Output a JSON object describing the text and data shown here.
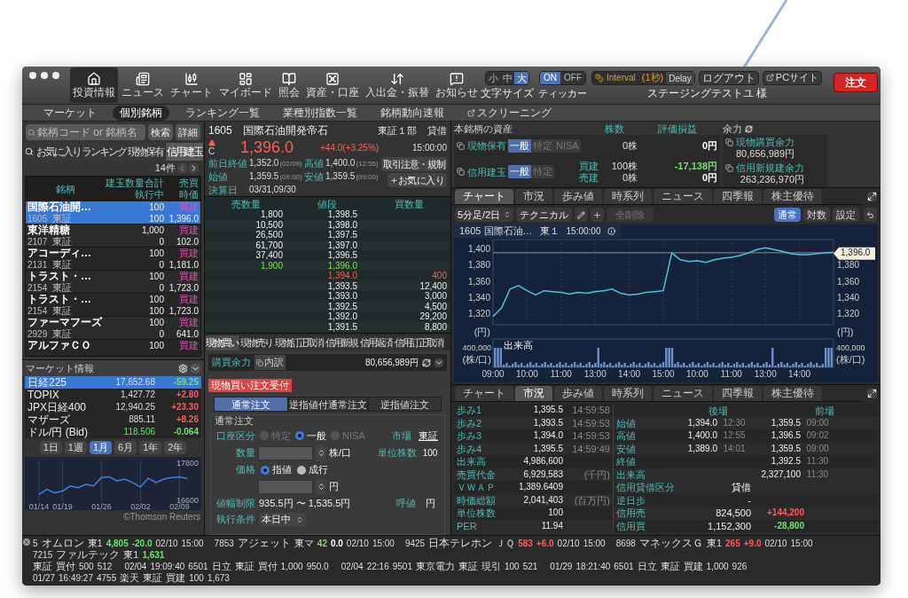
{
  "toolbar": {
    "nav": [
      {
        "label": "投資情報",
        "selected": true
      },
      {
        "label": "ニュース",
        "selected": false
      },
      {
        "label": "チャート",
        "selected": false
      },
      {
        "label": "マイボード",
        "selected": false
      },
      {
        "label": "照会",
        "selected": false
      },
      {
        "label": "資産・口座",
        "selected": false
      },
      {
        "label": "入出金・振替",
        "selected": false
      },
      {
        "label": "お知らせ",
        "selected": false
      }
    ],
    "font_size": {
      "label": "文字サイズ",
      "options": [
        {
          "label": "小",
          "selected": false
        },
        {
          "label": "中",
          "selected": false
        },
        {
          "label": "大",
          "selected": true
        }
      ]
    },
    "ticker_toggle": {
      "label": "ティッカー",
      "options": [
        {
          "label": "ON",
          "selected": true
        },
        {
          "label": "OFF",
          "selected": false
        }
      ]
    },
    "interval": {
      "label": "Interval",
      "value": "(1秒)",
      "button": "Delay"
    },
    "user": {
      "name": "ステージングテストユ",
      "suffix": "様"
    },
    "logout": "ログアウト",
    "pc_site": "PCサイト",
    "order": "注文"
  },
  "subnav": [
    {
      "label": "マーケット",
      "selected": false,
      "kind": "tab"
    },
    {
      "label": "個別銘柄",
      "selected": true,
      "kind": "tab"
    },
    {
      "label": "ランキング一覧",
      "selected": false,
      "kind": "tab"
    },
    {
      "label": "業種別指数一覧",
      "selected": false,
      "kind": "tab"
    },
    {
      "label": "銘柄動向速報",
      "selected": false,
      "kind": "tab"
    },
    {
      "label": "スクリーニング",
      "selected": false,
      "kind": "external"
    }
  ],
  "watchlist": {
    "search": {
      "placeholder": "銘柄コード or 銘柄名",
      "buttons": [
        "検索",
        "詳細"
      ]
    },
    "tabs": [
      {
        "label": "お気に入り",
        "selected": false
      },
      {
        "label": "ランキング",
        "selected": false
      },
      {
        "label": "現物保有",
        "selected": false
      },
      {
        "label": "信用建玉",
        "selected": true
      }
    ],
    "count": "14件",
    "columns": [
      [
        "銘柄"
      ],
      [
        "建玉数量合計",
        "執行中"
      ],
      [
        "売買",
        "時価"
      ]
    ],
    "rows": [
      {
        "name": "国際石油開…",
        "code": "1605",
        "market": "東証",
        "qty": "100",
        "pending": "100",
        "side": "買建",
        "price": "1,396.0",
        "selected": true
      },
      {
        "name": "東洋精糖",
        "code": "2107",
        "market": "東証",
        "qty": "1,000",
        "pending": "0",
        "side": "買建",
        "price": "102.0",
        "selected": false
      },
      {
        "name": "アコーディ…",
        "code": "2131",
        "market": "東証",
        "qty": "100",
        "pending": "0",
        "side": "買建",
        "price": "1,181.0",
        "selected": false
      },
      {
        "name": "トラスト・…",
        "code": "2154",
        "market": "東証",
        "qty": "100",
        "pending": "0",
        "side": "買建",
        "price": "1,723.0",
        "selected": false
      },
      {
        "name": "トラスト・…",
        "code": "2154",
        "market": "東証",
        "qty": "100",
        "pending": "100",
        "side": "買建",
        "price": "1,723.0",
        "selected": false
      },
      {
        "name": "ファーマフーズ",
        "code": "2929",
        "market": "東証",
        "qty": "100",
        "pending": "0",
        "side": "買建",
        "price": "641.0",
        "selected": false
      },
      {
        "name": "アルファＣＯ",
        "qty": "100",
        "side": "買建",
        "selected": false
      }
    ]
  },
  "market_info": {
    "title": "マーケット情報",
    "rows": [
      {
        "name": "日経225",
        "value": "17,652.68",
        "change": "-59.25",
        "color": "#6ee06e",
        "selected": true,
        "value_highlight": false
      },
      {
        "name": "TOPIX",
        "value": "1,427.72",
        "change": "+2.80",
        "color": "#ff5b5b",
        "selected": false,
        "value_highlight": false
      },
      {
        "name": "JPX日経400",
        "value": "12,940.25",
        "change": "+23.30",
        "color": "#ff5b5b",
        "selected": false,
        "value_highlight": false
      },
      {
        "name": "マザーズ",
        "value": "885.11",
        "change": "+8.26",
        "color": "#ff5b5b",
        "selected": false,
        "value_highlight": false
      },
      {
        "name": "ドル/円 (Bid)",
        "value": "118.506",
        "change": "-0.064",
        "color": "#6ee06e",
        "selected": false,
        "value_highlight": true
      }
    ],
    "periods": [
      {
        "label": "1日",
        "selected": false
      },
      {
        "label": "1週",
        "selected": false
      },
      {
        "label": "1月",
        "selected": true
      },
      {
        "label": "6月",
        "selected": false
      },
      {
        "label": "1年",
        "selected": false
      },
      {
        "label": "2年",
        "selected": false
      }
    ],
    "chart_data": {
      "type": "line",
      "grid": true,
      "categories": [
        "01/14",
        null,
        null,
        "01/19",
        null,
        null,
        null,
        null,
        "01/26",
        null,
        null,
        null,
        null,
        "02/02",
        null,
        null,
        null,
        null,
        "02/09",
        null
      ],
      "ylim": [
        16600,
        17800
      ],
      "yticks": [
        16600,
        17800
      ],
      "series": [
        {
          "color": "#3f7fd8",
          "values": [
            16800,
            16950,
            16850,
            16900,
            17050,
            17000,
            17100,
            17050,
            17300,
            17320,
            17200,
            17250,
            17150,
            17020,
            17280,
            17150,
            17250,
            17300,
            17320,
            17270
          ]
        }
      ]
    },
    "credit": "©Thomson Reuters"
  },
  "quote": {
    "code": "1605",
    "name": "国際石油開発帝石",
    "market": "東証１部",
    "margin": "貸借",
    "rising": true,
    "color": "#ff5b5b",
    "flag": "C",
    "price": "1,396.0",
    "change": "+44.0(+3.25%)",
    "time": "15:00:00",
    "stats": [
      {
        "label": "前日終値",
        "value": "1,352.0",
        "note": "(02/09)"
      },
      {
        "label": "高値",
        "value": "1,400.0",
        "note": "(12:55)"
      },
      {
        "label": "始値",
        "value": "1,359.5",
        "note": "(09:00)"
      },
      {
        "label": "安値",
        "value": "1,359.5",
        "note": "(09:00)"
      },
      {
        "label": "決算日",
        "value": "03/31,09/30"
      }
    ],
    "buttons": {
      "caution": "取引注意・規制",
      "favorite": "お気に入り"
    }
  },
  "order_book": {
    "columns": [
      "売数量",
      "値段",
      "買数量"
    ],
    "rows": [
      {
        "kind": "sell",
        "sell_qty": "1,800",
        "price": "1,398.5"
      },
      {
        "kind": "sell",
        "sell_qty": "10,500",
        "price": "1,398.0"
      },
      {
        "kind": "sell",
        "sell_qty": "26,500",
        "price": "1,397.5"
      },
      {
        "kind": "sell",
        "sell_qty": "61,700",
        "price": "1,397.0"
      },
      {
        "kind": "sell",
        "sell_qty": "37,400",
        "price": "1,396.5"
      },
      {
        "kind": "current",
        "sell_qty": "1,900",
        "price": "1,396.0"
      },
      {
        "kind": "best_buy",
        "price": "1,394.0",
        "buy_qty": "400"
      },
      {
        "kind": "buy",
        "price": "1,393.5",
        "buy_qty": "12,400"
      },
      {
        "kind": "buy",
        "price": "1,393.0",
        "buy_qty": "3,000"
      },
      {
        "kind": "buy",
        "price": "1,392.5",
        "buy_qty": "4,500"
      },
      {
        "kind": "buy",
        "price": "1,392.0",
        "buy_qty": "29,200"
      },
      {
        "kind": "buy",
        "price": "1,391.5",
        "buy_qty": "8,800"
      }
    ]
  },
  "order": {
    "tabs": [
      {
        "label": "現物買い",
        "selected": true
      },
      {
        "label": "現物売り",
        "selected": false
      },
      {
        "label": "現物訂正取消",
        "selected": false
      },
      {
        "label": "信用新規",
        "selected": false
      },
      {
        "label": "信用返済",
        "selected": false
      },
      {
        "label": "信用訂正取消",
        "selected": false
      }
    ],
    "power": {
      "label": "購買余力",
      "breakdown": "内訳",
      "value": "80,656,989円"
    },
    "status": "現物買い注文受付",
    "types": [
      {
        "label": "通常注文",
        "selected": true
      },
      {
        "label": "逆指値付通常注文",
        "selected": false
      },
      {
        "label": "逆指値注文",
        "selected": false
      }
    ],
    "legend": "通常注文",
    "account": {
      "label": "口座区分",
      "options": [
        {
          "label": "特定",
          "selected": false,
          "disabled": true
        },
        {
          "label": "一般",
          "selected": true,
          "disabled": false
        },
        {
          "label": "NISA",
          "selected": false,
          "disabled": true
        }
      ]
    },
    "market": {
      "label": "市場",
      "value": "東証"
    },
    "quantity": {
      "label": "数量",
      "unit": "株/口"
    },
    "unit_shares": {
      "label": "単位株数",
      "value": "100"
    },
    "price": {
      "label": "価格",
      "options": [
        {
          "label": "指値",
          "selected": true,
          "disabled": false
        },
        {
          "label": "成行",
          "selected": false,
          "disabled": false
        }
      ],
      "unit": "円"
    },
    "limit": {
      "label": "値幅制限",
      "value": "935.5円 〜 1,535.5円"
    },
    "tick": {
      "label": "呼値",
      "value": "円"
    },
    "condition": {
      "label": "執行条件",
      "value": "本日中"
    }
  },
  "assets": {
    "title": "本銘柄の資産",
    "columns": [
      "株数",
      "評価損益"
    ],
    "power_title": "余力",
    "rows": [
      {
        "label": "現物保有",
        "accounts": [
          {
            "label": "一般",
            "selected": true
          },
          {
            "label": "特定",
            "selected": false
          },
          {
            "label": "NISA",
            "selected": false
          }
        ],
        "lines": [
          {
            "shares": "0株",
            "pl": "0円",
            "color": "#ffffff"
          }
        ]
      },
      {
        "label": "信用建玉",
        "accounts": [
          {
            "label": "一般",
            "selected": true
          },
          {
            "label": "特定",
            "selected": false
          }
        ],
        "lines": [
          {
            "side": "買建",
            "shares": "100株",
            "pl": "-17,138円",
            "color": "#6ee06e"
          },
          {
            "side": "売建",
            "shares": "0株",
            "pl": "0円",
            "color": "#ffffff"
          }
        ]
      }
    ],
    "power": [
      {
        "label": "現物購買余力",
        "value": "80,656,989円"
      },
      {
        "label": "信用新規建余力",
        "value": "263,236,970円"
      }
    ]
  },
  "chart_panel": {
    "tabs": [
      {
        "label": "チャート",
        "selected": true
      },
      {
        "label": "市況",
        "selected": false
      },
      {
        "label": "歩み値",
        "selected": false
      },
      {
        "label": "時系列",
        "selected": false
      },
      {
        "label": "ニュース",
        "selected": false
      },
      {
        "label": "四季報",
        "selected": false
      },
      {
        "label": "株主優待",
        "selected": false
      }
    ],
    "period": "5分足/2日",
    "technical": "テクニカル",
    "clear": "全削除",
    "scales": [
      {
        "label": "通常",
        "selected": true
      },
      {
        "label": "対数",
        "selected": false
      },
      {
        "label": "設定",
        "selected": false
      }
    ],
    "legend": {
      "name": "1605 国際石油…",
      "market": "東１",
      "time": "15:00:00"
    },
    "last_label": "1,396.0",
    "units": [
      "(円)",
      "(円)"
    ],
    "volume_label": "出来高",
    "volume_ticks": [
      "400,000",
      "400,000"
    ],
    "volume_units": [
      "(株/口)",
      "(株/口)"
    ],
    "chart_data": {
      "type": "line",
      "grid": true,
      "ref_lines": [
        {
          "axis": "y",
          "value": 1396
        }
      ],
      "categories": [
        "09:00",
        null,
        null,
        null,
        "10:00",
        null,
        null,
        null,
        "11:00",
        null,
        null,
        null,
        "13:00",
        null,
        null,
        null,
        "14:00",
        null,
        null,
        null,
        "15:00",
        null,
        null,
        null,
        "10:00",
        null,
        null,
        null,
        "11:00",
        null,
        null,
        null,
        "13:00",
        null,
        null,
        null,
        "14:00",
        null,
        null,
        null,
        null
      ],
      "ylim": [
        1310,
        1410
      ],
      "yticks": [
        {
          "value": 1320,
          "label": "1,320"
        },
        {
          "value": 1340,
          "label": "1,340"
        },
        {
          "value": 1360,
          "label": "1,360"
        },
        {
          "value": 1380,
          "label": "1,380"
        },
        {
          "value": 1400,
          "label": "1,400"
        }
      ],
      "series": [
        {
          "color": "#4fc3d9",
          "values": [
            1320,
            1330,
            1352,
            1356,
            1350,
            1345,
            1350,
            1349,
            1348,
            1346,
            1348,
            1347,
            1349,
            1350,
            1352,
            1347,
            1345,
            1346,
            1348,
            1349,
            1350,
            1394,
            1386,
            1384,
            1385,
            1383,
            1386,
            1388,
            1389,
            1391,
            1394,
            1398,
            1400,
            1398,
            1396,
            1393,
            1392,
            1392,
            1393,
            1394,
            1395
          ]
        }
      ]
    }
  },
  "quote_panel": {
    "tabs": [
      {
        "label": "チャート",
        "selected": false
      },
      {
        "label": "市況",
        "selected": true
      },
      {
        "label": "歩み値",
        "selected": false
      },
      {
        "label": "時系列",
        "selected": false
      },
      {
        "label": "ニュース",
        "selected": false
      },
      {
        "label": "四季報",
        "selected": false
      },
      {
        "label": "株主優待",
        "selected": false
      }
    ],
    "left_rows": [
      {
        "label": "歩み1",
        "value": "1,395.5",
        "note": "14:59:58"
      },
      {
        "label": "歩み2",
        "value": "1,393.5",
        "note": "14:59:53"
      },
      {
        "label": "歩み3",
        "value": "1,394.0",
        "note": "14:59:53"
      },
      {
        "label": "歩み4",
        "value": "1,395.5",
        "note": "14:59:49"
      },
      {
        "label": "出来高",
        "value": "4,986,600"
      },
      {
        "label": "売買代金",
        "value": "6,929,583",
        "note": "(千円)"
      },
      {
        "label": "ＶＷＡＰ",
        "value": "1,389.6409"
      },
      {
        "label": "時価総額",
        "value": "2,041,403",
        "note": "(百万円)"
      },
      {
        "label": "単位株数",
        "value": "100"
      },
      {
        "label": "PER",
        "value": "11.94"
      }
    ],
    "sessions": [
      "後場",
      "前場"
    ],
    "session_rows": [
      {
        "label": "始値",
        "pm": {
          "value": "1,394.0",
          "time": "12:30"
        },
        "am": {
          "value": "1,359.5",
          "time": "09:00"
        }
      },
      {
        "label": "高値",
        "pm": {
          "value": "1,400.0",
          "time": "12:55"
        },
        "am": {
          "value": "1,396.5",
          "time": "09:02"
        }
      },
      {
        "label": "安値",
        "pm": {
          "value": "1,389.0",
          "time": "14:01"
        },
        "am": {
          "value": "1,359.5",
          "time": "09:00"
        }
      },
      {
        "label": "終値",
        "am": {
          "value": "1,392.5",
          "time": "11:30"
        }
      },
      {
        "label": "出来高",
        "am": {
          "value": "2,327,100",
          "time": "11:30"
        }
      }
    ],
    "margin_rows": [
      {
        "label": "信用貸借区分",
        "value": "貸借"
      },
      {
        "label": "逆日歩",
        "value": "-"
      },
      {
        "label": "信用売",
        "value": "824,500",
        "change": "+144,200",
        "color": "#ff5b5b"
      },
      {
        "label": "信用買",
        "value": "1,152,300",
        "change": "-28,800",
        "color": "#6ee06e"
      }
    ]
  },
  "ticker": {
    "quotes": [
      {
        "code": "5",
        "name": "オムロン",
        "market": "東1",
        "price": {
          "value": "4,805",
          "color": "#6ee06e"
        },
        "change": {
          "value": "-20.0",
          "color": "#6ee06e"
        },
        "date": "02/10",
        "time": "15:00"
      },
      {
        "code": "7853",
        "name": "アジェット",
        "market": "東マ",
        "price": {
          "value": "42",
          "color": "#8fd06e"
        },
        "change": {
          "value": "0.0",
          "color": "#ffffff"
        },
        "date": "02/10",
        "time": "15:00"
      },
      {
        "code": "9425",
        "name": "日本テレホン",
        "market": "ＪＱ",
        "price": {
          "value": "583",
          "color": "#ff5b5b"
        },
        "change": {
          "value": "+6.0",
          "color": "#ff5b5b"
        },
        "date": "02/10",
        "time": "15:00"
      },
      {
        "code": "8698",
        "name": "マネックスＧ",
        "market": "東1",
        "price": {
          "value": "265",
          "color": "#ff5b5b"
        },
        "change": {
          "value": "+9.0",
          "color": "#ff5b5b"
        },
        "date": "02/10",
        "time": "15:00"
      },
      {
        "code": "7215",
        "name": "ファルテック",
        "market": "東1",
        "price": {
          "value": "1,631",
          "color": "#6ee06e"
        }
      }
    ],
    "trades": [
      {
        "market": "東証",
        "side": "買付",
        "qty": "500",
        "price": "512"
      },
      {
        "date": "02/04",
        "time": "19:09:40",
        "code": "6501",
        "name": "日立",
        "market": "東証",
        "side": "買付",
        "qty": "1,000",
        "price": "950.0"
      },
      {
        "date": "02/04",
        "time": "22:16",
        "code": "9501",
        "name": "東京電力",
        "market": "東証",
        "side": "現引",
        "qty": "100",
        "price": "521"
      },
      {
        "date": "01/29",
        "time": "18:21:40",
        "code": "6501",
        "name": "日立",
        "market": "東証",
        "side": "買建",
        "qty": "1,000",
        "price": "926"
      },
      {
        "date": "01/27",
        "time": "16:49:27",
        "code": "4755",
        "name": "楽天",
        "market": "東証",
        "side": "買建",
        "qty": "100",
        "price": "1,673"
      }
    ]
  }
}
